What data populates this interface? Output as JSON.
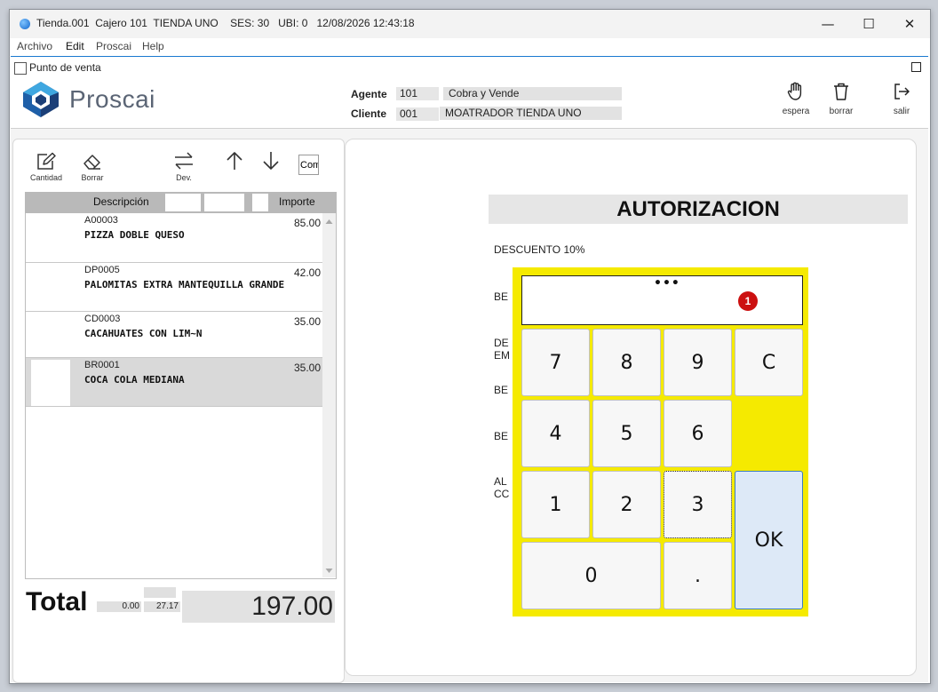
{
  "window": {
    "title": "Tienda.001  Cajero 101  TIENDA UNO    SES: 30   UBI: 0   12/08/2026 12:43:18",
    "minimize": "—",
    "maximize": "☐",
    "close": "✕"
  },
  "menu": [
    "Archivo",
    "Edit",
    "Proscai",
    "Help"
  ],
  "pos": {
    "title": "Punto de venta",
    "logo_text": "Proscai",
    "agente_label": "Agente",
    "agente_code": "101",
    "agente_name": "Cobra y Vende",
    "cliente_label": "Cliente",
    "cliente_code": "001",
    "cliente_name": "MOATRADOR TIENDA UNO",
    "actions": [
      "espera",
      "borrar",
      "salir"
    ]
  },
  "left_toolbar": {
    "cantidad": "Cantidad",
    "borrar": "Borrar",
    "dev": "Dev.",
    "com": "Com"
  },
  "grid": {
    "headers": {
      "descripcion": "Descripción",
      "importe": "Importe"
    },
    "rows": [
      {
        "code": "A00003",
        "desc": "PIZZA DOBLE QUESO",
        "amount": "85.00"
      },
      {
        "code": "DP0005",
        "desc": "PALOMITAS EXTRA MANTEQUILLA GRANDE",
        "amount": "42.00"
      },
      {
        "code": "CD0003",
        "desc": "CACAHUATES CON LIM~N",
        "amount": "35.00"
      },
      {
        "code": "BR0001",
        "desc": "COCA COLA MEDIANA",
        "amount": "35.00"
      }
    ]
  },
  "totals": {
    "label": "Total",
    "discount": "0.00",
    "tax": "27.17",
    "total": "197.00"
  },
  "auth": {
    "title": "AUTORIZACION",
    "bg_items": [
      "DESCUENTO 10%",
      "BE",
      "DE\nEM",
      "BE",
      "BE",
      "AL\nCC"
    ],
    "password_mask": "•••",
    "badge": "1",
    "keys": [
      "7",
      "8",
      "9",
      "C",
      "4",
      "5",
      "6",
      "1",
      "2",
      "3",
      "OK",
      "0",
      "."
    ]
  },
  "colors": {
    "keypad_bg": "#f5ea00",
    "ok_key": "#dde9f7",
    "badge": "#cc1010",
    "accent": "#1a79d0"
  }
}
